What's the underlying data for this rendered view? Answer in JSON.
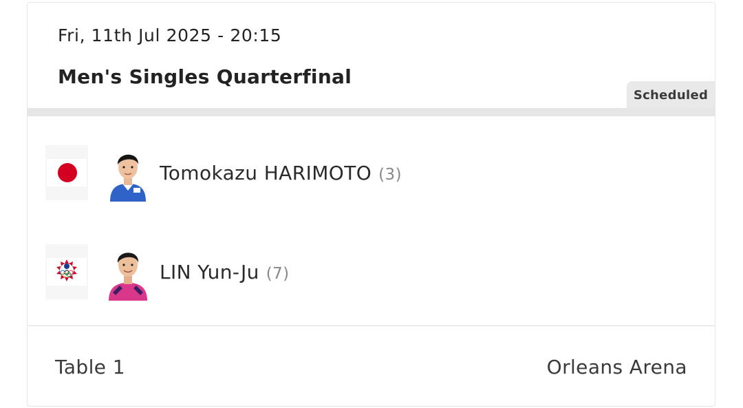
{
  "match": {
    "datetime": "Fri, 11th Jul 2025 - 20:15",
    "title": "Men's Singles Quarterfinal",
    "status": "Scheduled"
  },
  "players": [
    {
      "name": "Tomokazu HARIMOTO",
      "seed": "(3)",
      "flag_icon": "japan-flag-icon",
      "jersey_color": "#2f63c7"
    },
    {
      "name": "LIN Yun-Ju",
      "seed": "(7)",
      "flag_icon": "chinese-taipei-olympic-flag-icon",
      "jersey_color": "#d9388a"
    }
  ],
  "footer": {
    "table": "Table 1",
    "venue": "Orleans Arena"
  },
  "colors": {
    "status_badge_bg": "#e9e9e9",
    "divider": "#e6e6e6",
    "seed_text": "#888888"
  }
}
